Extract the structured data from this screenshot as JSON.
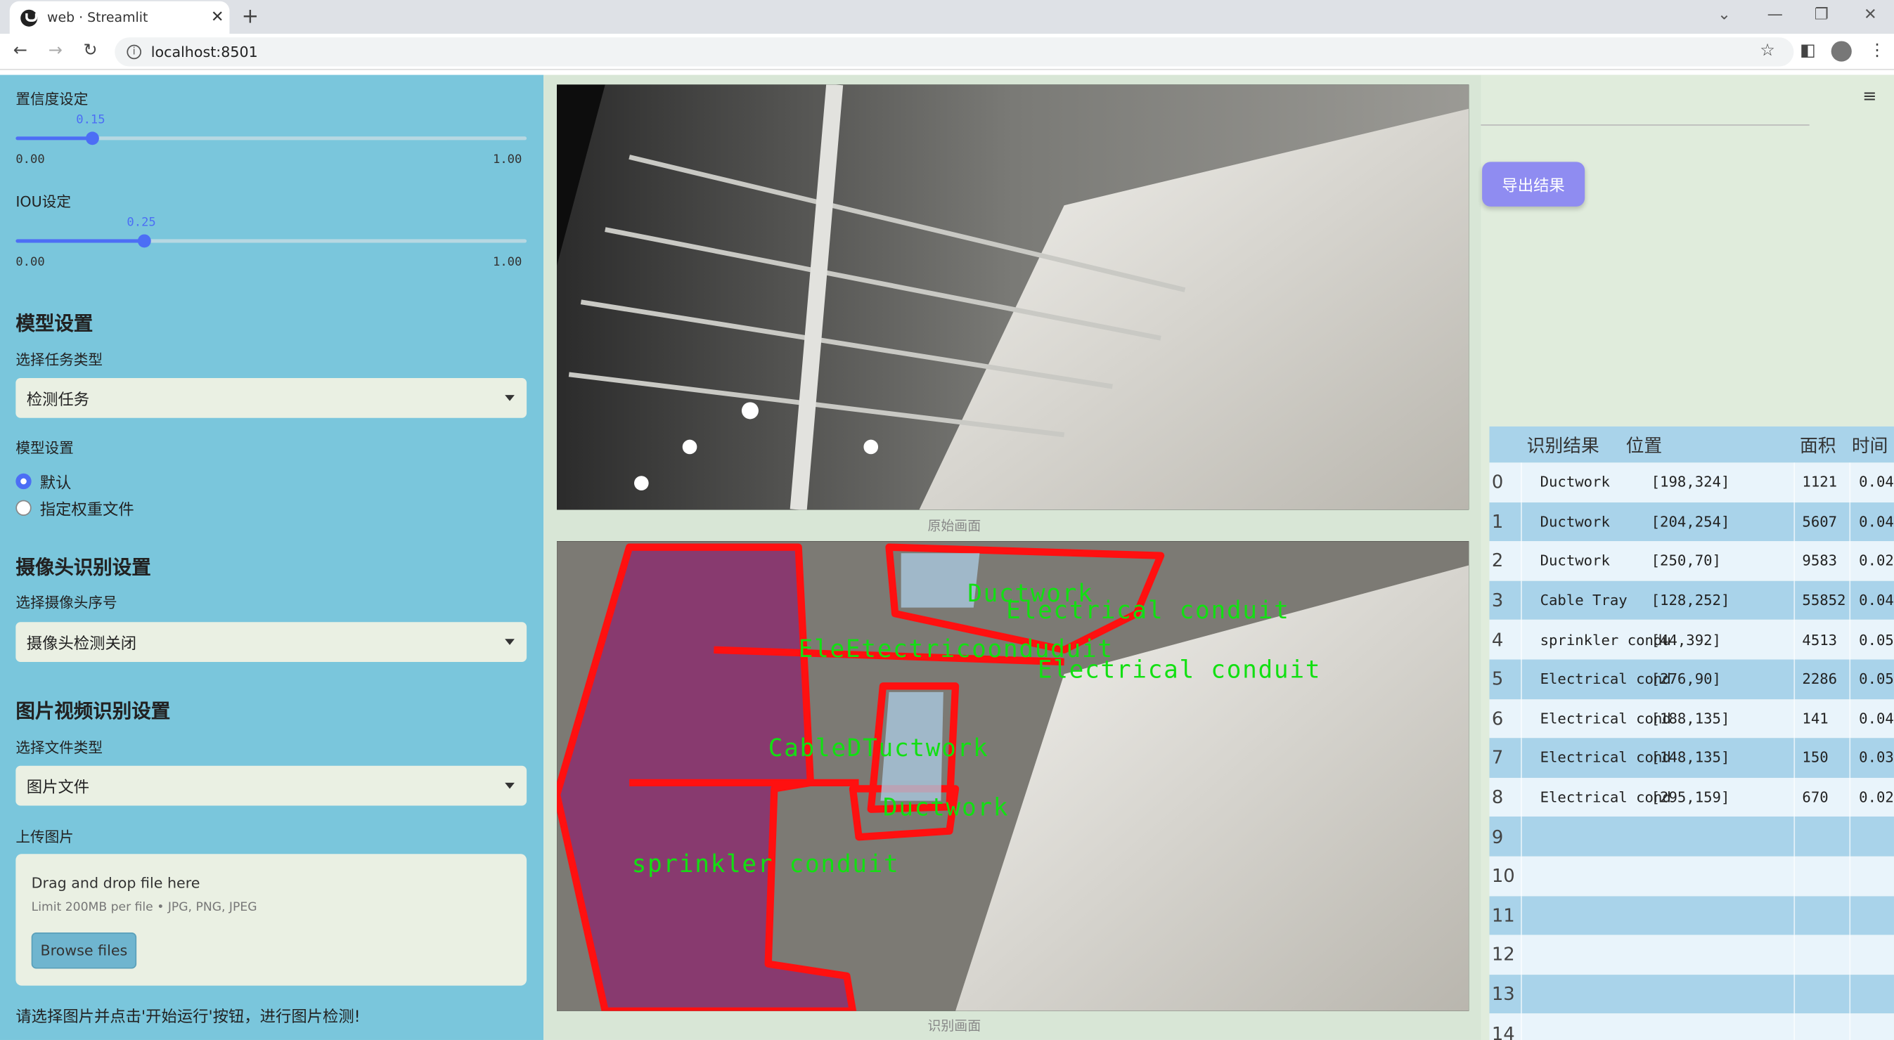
{
  "browser": {
    "tab_title": "web · Streamlit",
    "url": "localhost:8501",
    "close": "✕",
    "new_tab": "+",
    "window_controls": [
      "⌄",
      "—",
      "❐",
      "✕"
    ]
  },
  "sidebar": {
    "conf_label": "置信度设定",
    "conf_value": "0.15",
    "conf_min": "0.00",
    "conf_max": "1.00",
    "conf_level": 0.15,
    "iou_label": "IOU设定",
    "iou_value": "0.25",
    "iou_min": "0.00",
    "iou_max": "1.00",
    "iou_level": 0.25,
    "model_header": "模型设置",
    "task_label": "选择任务类型",
    "task_value": "检测任务",
    "model_label": "模型设置",
    "radio_default": "默认",
    "radio_custom": "指定权重文件",
    "camera_header": "摄像头识别设置",
    "camera_label": "选择摄像头序号",
    "camera_value": "摄像头检测关闭",
    "media_header": "图片视频识别设置",
    "file_type_label": "选择文件类型",
    "file_type_value": "图片文件",
    "upload_label": "上传图片",
    "upload_drag": "Drag and drop file here",
    "upload_limit": "Limit 200MB per file • JPG, PNG, JPEG",
    "browse": "Browse files",
    "hint": "请选择图片并点击'开始运行'按钮，进行图片检测!"
  },
  "main": {
    "caption_original": "原始画面",
    "caption_detect": "识别画面",
    "overlay_labels": [
      "Ductwork",
      "Electrical conduit",
      "EleEtectricoonduduit",
      "Electrical conduit",
      "CableDTuctwork",
      "Ductwork",
      "sprinkler conduit"
    ]
  },
  "right": {
    "export": "导出结果",
    "menu_icon": "≡",
    "headers": [
      "识别结果",
      "位置",
      "面积",
      "时间"
    ],
    "rows": [
      {
        "idx": "0",
        "name": "Ductwork",
        "pos": "[198,324]",
        "area": "1121",
        "time": "0.04"
      },
      {
        "idx": "1",
        "name": "Ductwork",
        "pos": "[204,254]",
        "area": "5607",
        "time": "0.04"
      },
      {
        "idx": "2",
        "name": "Ductwork",
        "pos": "[250,70]",
        "area": "9583",
        "time": "0.02"
      },
      {
        "idx": "3",
        "name": "Cable Tray",
        "pos": "[128,252]",
        "area": "55852",
        "time": "0.04"
      },
      {
        "idx": "4",
        "name": "sprinkler condu",
        "pos": "[44,392]",
        "area": "4513",
        "time": "0.05"
      },
      {
        "idx": "5",
        "name": "Electrical cond",
        "pos": "[276,90]",
        "area": "2286",
        "time": "0.05"
      },
      {
        "idx": "6",
        "name": "Electrical cond",
        "pos": "[188,135]",
        "area": "141",
        "time": "0.04"
      },
      {
        "idx": "7",
        "name": "Electrical cond",
        "pos": "[148,135]",
        "area": "150",
        "time": "0.03"
      },
      {
        "idx": "8",
        "name": "Electrical cond",
        "pos": "[295,159]",
        "area": "670",
        "time": "0.02"
      },
      {
        "idx": "9",
        "name": "",
        "pos": "",
        "area": "",
        "time": ""
      },
      {
        "idx": "10",
        "name": "",
        "pos": "",
        "area": "",
        "time": ""
      },
      {
        "idx": "11",
        "name": "",
        "pos": "",
        "area": "",
        "time": ""
      },
      {
        "idx": "12",
        "name": "",
        "pos": "",
        "area": "",
        "time": ""
      },
      {
        "idx": "13",
        "name": "",
        "pos": "",
        "area": "",
        "time": ""
      },
      {
        "idx": "14",
        "name": "",
        "pos": "",
        "area": "",
        "time": ""
      }
    ]
  }
}
